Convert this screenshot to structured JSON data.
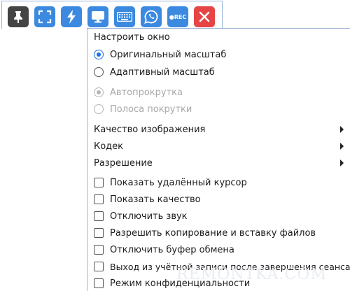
{
  "toolbar": {
    "buttons": [
      {
        "name": "pin-icon"
      },
      {
        "name": "fullscreen-icon"
      },
      {
        "name": "lightning-icon"
      },
      {
        "name": "monitor-icon"
      },
      {
        "name": "keyboard-icon"
      },
      {
        "name": "chat-icon"
      },
      {
        "name": "record-icon",
        "label": "●REC"
      },
      {
        "name": "close-icon"
      }
    ]
  },
  "menu": {
    "title": "Настроить окно",
    "scale_original": "Оригинальный масштаб",
    "scale_adaptive": "Адаптивный масштаб",
    "autoscroll": "Автопрокрутка",
    "scrollbar": "Полоса покрутки",
    "image_quality": "Качество изображения",
    "codec": "Кодек",
    "resolution": "Разрешение",
    "show_remote_cursor": "Показать удалённый курсор",
    "show_quality": "Показать качество",
    "mute": "Отключить звук",
    "allow_file_copy_paste": "Разрешить копирование и вставку файлов",
    "disable_clipboard": "Отключить буфер обмена",
    "logout_after_session": "Выход из учётной записи после завершения сеанса",
    "privacy_mode": "Режим конфиденциальности"
  },
  "watermark": "REMONTKA.COM",
  "colors": {
    "accent": "#1a73e8",
    "toolbar_blue": "#3b8ae0",
    "close_red": "#e64545"
  }
}
